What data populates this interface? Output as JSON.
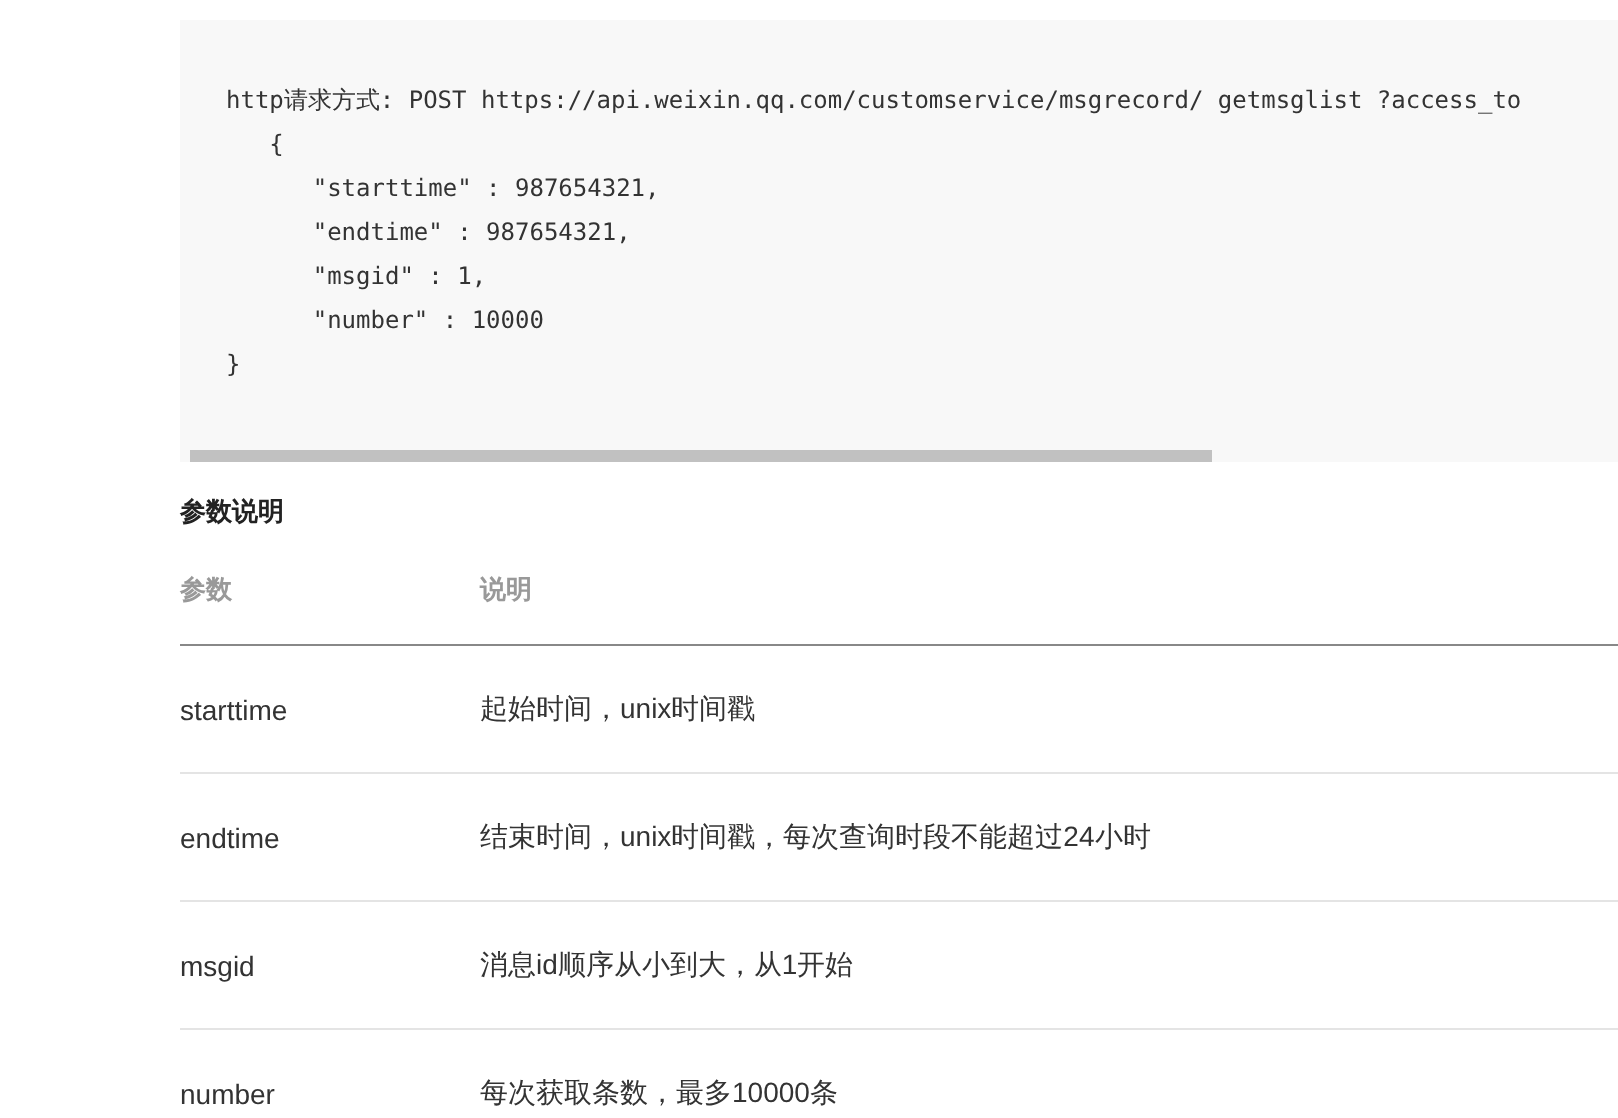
{
  "code_block": {
    "lines": [
      "http请求方式: POST https://api.weixin.qq.com/customservice/msgrecord/ getmsglist ?access_to",
      "   {",
      "      \"starttime\" : 987654321,",
      "      \"endtime\" : 987654321,",
      "      \"msgid\" : 1,",
      "      \"number\" : 10000",
      "}"
    ]
  },
  "section_title": "参数说明",
  "table": {
    "columns": [
      "参数",
      "说明"
    ],
    "rows": [
      [
        "starttime",
        "起始时间，unix时间戳"
      ],
      [
        "endtime",
        "结束时间，unix时间戳，每次查询时段不能超过24小时"
      ],
      [
        "msgid",
        "消息id顺序从小到大，从1开始"
      ],
      [
        "number",
        "每次获取条数，最多10000条"
      ]
    ]
  }
}
